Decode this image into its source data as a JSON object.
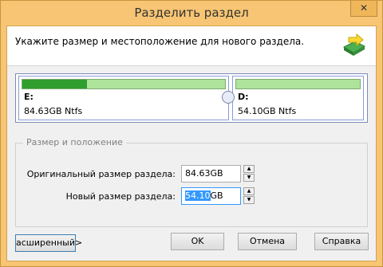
{
  "window": {
    "title": "Разделить раздел",
    "close_icon": "close-icon",
    "accent": "#f7c573"
  },
  "header": {
    "description": "Укажите размер и местоположение для нового раздела.",
    "icon": "split-partition-icon"
  },
  "disk": {
    "left": {
      "letter": "E:",
      "info": "84.63GB Ntfs",
      "used_fraction": 0.32
    },
    "right": {
      "letter": "D:",
      "info": "54.10GB Ntfs",
      "used_fraction": 0.0
    }
  },
  "group": {
    "title": "Размер и положение",
    "original_label": "Оригинальный размер раздела:",
    "original_value": "84.63GB",
    "new_label": "Новый размер раздела:",
    "new_value_selected": "54.10",
    "new_value_unit": "GB"
  },
  "buttons": {
    "advanced": "асширенный>",
    "ok": "OK",
    "cancel": "Отмена",
    "help": "Справка"
  }
}
